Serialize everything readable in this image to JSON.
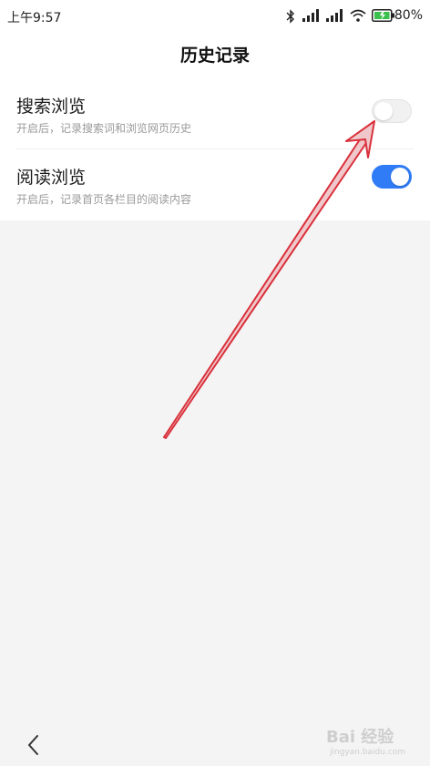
{
  "status_bar": {
    "time": "上午9:57",
    "battery": "80%",
    "icons": [
      "bluetooth-icon",
      "signal-icon",
      "signal-icon",
      "wifi-icon",
      "battery-charging-icon"
    ]
  },
  "header": {
    "title": "历史记录"
  },
  "settings": [
    {
      "title": "搜索浏览",
      "description": "开启后，记录搜索词和浏览网页历史",
      "enabled": false
    },
    {
      "title": "阅读浏览",
      "description": "开启后，记录首页各栏目的阅读内容",
      "enabled": true
    }
  ],
  "colors": {
    "accent": "#2f7cf6",
    "annotation_arrow": "#d9303b",
    "background": "#f4f4f4"
  },
  "nav": {
    "back_icon": "chevron-left-icon"
  },
  "watermark": {
    "main": "Bai 经验",
    "sub": "jingyan.baidu.com"
  }
}
